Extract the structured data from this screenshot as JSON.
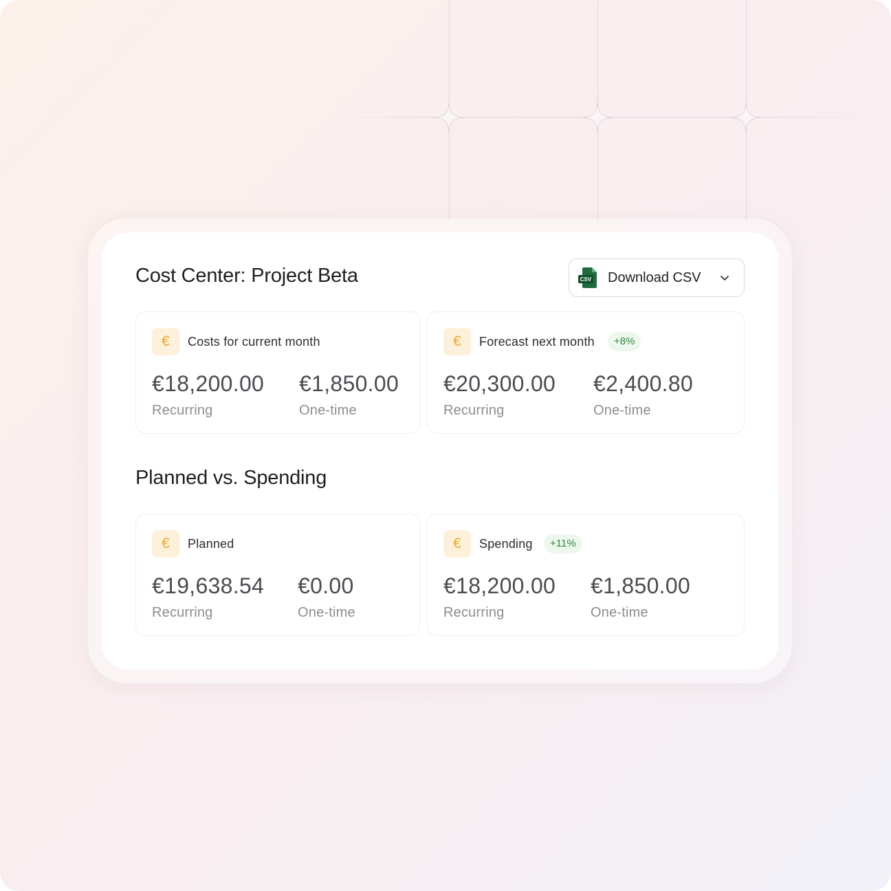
{
  "header": {
    "title": "Cost Center: Project Beta",
    "download": {
      "icon_text": "CSV",
      "label": "Download CSV"
    }
  },
  "section2": {
    "title": "Planned vs. Spending"
  },
  "cards": {
    "current": {
      "currency": "€",
      "label": "Costs for current month",
      "recurring_value": "€18,200.00",
      "recurring_label": "Recurring",
      "onetime_value": "€1,850.00",
      "onetime_label": "One-time"
    },
    "forecast": {
      "currency": "€",
      "label": "Forecast next month",
      "badge": "+8%",
      "recurring_value": "€20,300.00",
      "recurring_label": "Recurring",
      "onetime_value": "€2,400.80",
      "onetime_label": "One-time"
    },
    "planned": {
      "currency": "€",
      "label": "Planned",
      "recurring_value": "€19,638.54",
      "recurring_label": "Recurring",
      "onetime_value": "€0.00",
      "onetime_label": "One-time"
    },
    "spending": {
      "currency": "€",
      "label": "Spending",
      "badge": "+11%",
      "recurring_value": "€18,200.00",
      "recurring_label": "Recurring",
      "onetime_value": "€1,850.00",
      "onetime_label": "One-time"
    }
  },
  "colors": {
    "euro_accent": "#f0a92a",
    "euro_bg": "#fdf1dc",
    "badge_text": "#2e8a3a",
    "badge_bg": "#eef7ee",
    "csv_icon": "#1f6b3f"
  },
  "icons": [
    "csv-file-icon",
    "chevron-down-icon",
    "euro-icon"
  ]
}
